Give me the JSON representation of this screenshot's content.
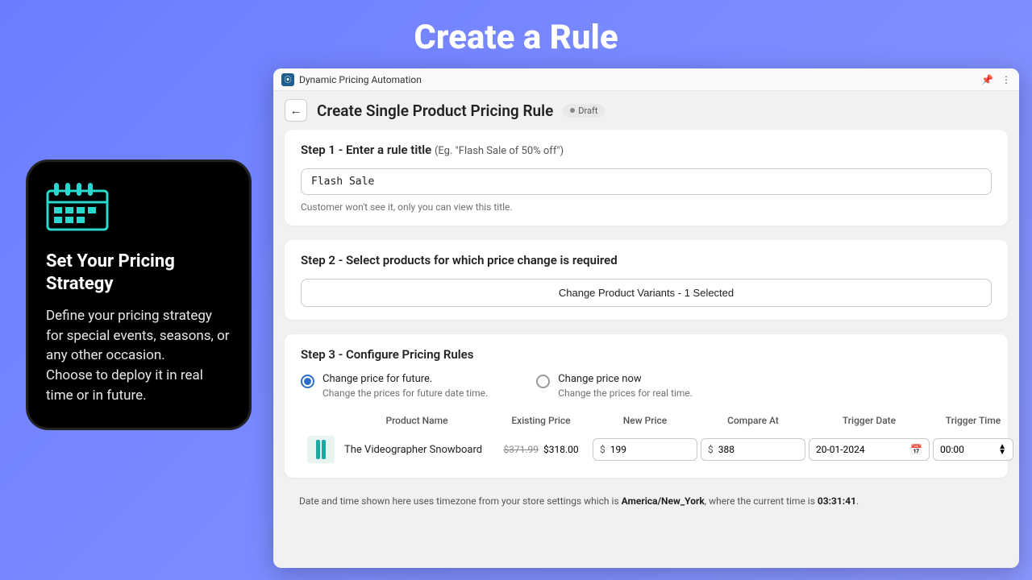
{
  "page": {
    "title": "Create a Rule"
  },
  "promo": {
    "heading": "Set Your Pricing Strategy",
    "line1": "Define your pricing strategy for special events, seasons, or any other occasion.",
    "line2": "Choose to deploy it in real time or in future."
  },
  "app": {
    "title": "Dynamic Pricing Automation",
    "header": "Create Single Product Pricing Rule",
    "badge": "Draft"
  },
  "step1": {
    "title": "Step 1 - Enter a rule title ",
    "hint": "(Eg. \"Flash Sale of 50% off\")",
    "value": "Flash Sale",
    "helper": "Customer won't see it, only you can view this title."
  },
  "step2": {
    "title": "Step 2 - Select products for which price change is required",
    "button": "Change Product Variants - 1 Selected"
  },
  "step3": {
    "title": "Step 3 - Configure Pricing Rules",
    "opt1": {
      "label": "Change price for future.",
      "sub": "Change the prices for future date time."
    },
    "opt2": {
      "label": "Change price now",
      "sub": "Change the prices for real time."
    }
  },
  "table": {
    "headers": {
      "product": "Product Name",
      "existing": "Existing Price",
      "new": "New Price",
      "compare": "Compare At",
      "date": "Trigger Date",
      "time": "Trigger Time"
    },
    "row": {
      "name": "The Videographer Snowboard",
      "old_price": "$371.99",
      "current_price": "$318.00",
      "new_price": "199",
      "compare_at": "388",
      "trigger_date": "20-01-2024",
      "trigger_time": "00:00"
    }
  },
  "tz": {
    "prefix": "Date and time shown here uses timezone from your store settings which is ",
    "zone": "America/New_York",
    "mid": ", where the current time is ",
    "time": "03:31:41",
    "suffix": "."
  }
}
